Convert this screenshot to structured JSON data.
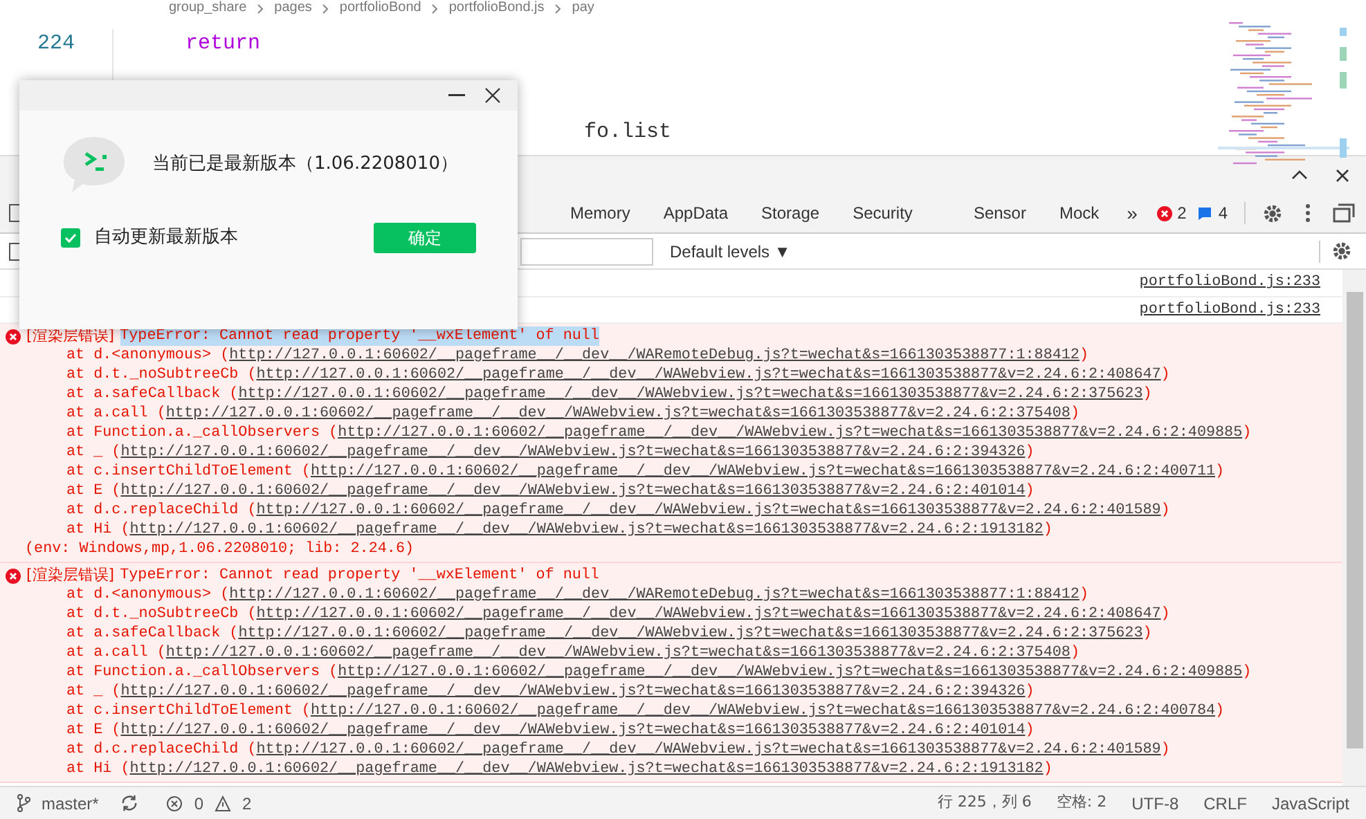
{
  "editor": {
    "breadcrumb": [
      "group_share",
      "pages",
      "portfolioBond",
      "portfolioBond.js",
      "pay"
    ],
    "lines": [
      {
        "number": "224",
        "code": "return"
      },
      {
        "code": "fo.list"
      }
    ]
  },
  "devtools": {
    "tabs": [
      {
        "label": "Memory",
        "selected": false
      },
      {
        "label": "AppData",
        "selected": false
      },
      {
        "label": "Storage",
        "selected": false
      },
      {
        "label": "Security",
        "selected": false
      },
      {
        "label": "Sensor",
        "selected": false
      },
      {
        "label": "Mock",
        "selected": false
      }
    ],
    "more_tabs": "»",
    "error_count": "2",
    "message_count": "4",
    "level_select": "Default levels ▼",
    "console": [
      {
        "kind": "log",
        "source": "portfolioBond.js:233"
      },
      {
        "kind": "log",
        "source": "portfolioBond.js:233"
      },
      {
        "kind": "error",
        "tag": "[渲染层错误]",
        "message": "TypeError: Cannot read property '__wxElement' of null",
        "highlighted": true,
        "stack": [
          {
            "fn": "at d.<anonymous> (",
            "url": "http://127.0.0.1:60602/__pageframe__/__dev__/WARemoteDebug.js?t=wechat&s=1661303538877:1:88412",
            "tail": ")"
          },
          {
            "fn": "at d.t._noSubtreeCb (",
            "url": "http://127.0.0.1:60602/__pageframe__/__dev__/WAWebview.js?t=wechat&s=1661303538877&v=2.24.6:2:408647",
            "tail": ")"
          },
          {
            "fn": "at a.safeCallback (",
            "url": "http://127.0.0.1:60602/__pageframe__/__dev__/WAWebview.js?t=wechat&s=1661303538877&v=2.24.6:2:375623",
            "tail": ")"
          },
          {
            "fn": "at a.call (",
            "url": "http://127.0.0.1:60602/__pageframe__/__dev__/WAWebview.js?t=wechat&s=1661303538877&v=2.24.6:2:375408",
            "tail": ")"
          },
          {
            "fn": "at Function.a._callObservers (",
            "url": "http://127.0.0.1:60602/__pageframe__/__dev__/WAWebview.js?t=wechat&s=1661303538877&v=2.24.6:2:409885",
            "tail": ")"
          },
          {
            "fn": "at _ (",
            "url": "http://127.0.0.1:60602/__pageframe__/__dev__/WAWebview.js?t=wechat&s=1661303538877&v=2.24.6:2:394326",
            "tail": ")"
          },
          {
            "fn": "at c.insertChildToElement (",
            "url": "http://127.0.0.1:60602/__pageframe__/__dev__/WAWebview.js?t=wechat&s=1661303538877&v=2.24.6:2:400711",
            "tail": ")"
          },
          {
            "fn": "at E (",
            "url": "http://127.0.0.1:60602/__pageframe__/__dev__/WAWebview.js?t=wechat&s=1661303538877&v=2.24.6:2:401014",
            "tail": ")"
          },
          {
            "fn": "at d.c.replaceChild (",
            "url": "http://127.0.0.1:60602/__pageframe__/__dev__/WAWebview.js?t=wechat&s=1661303538877&v=2.24.6:2:401589",
            "tail": ")"
          },
          {
            "fn": "at Hi (",
            "url": "http://127.0.0.1:60602/__pageframe__/__dev__/WAWebview.js?t=wechat&s=1661303538877&v=2.24.6:2:1913182",
            "tail": ")"
          }
        ],
        "env": "(env: Windows,mp,1.06.2208010; lib: 2.24.6)"
      },
      {
        "kind": "error",
        "tag": "[渲染层错误]",
        "message": "TypeError: Cannot read property '__wxElement' of null",
        "highlighted": false,
        "stack": [
          {
            "fn": "at d.<anonymous> (",
            "url": "http://127.0.0.1:60602/__pageframe__/__dev__/WARemoteDebug.js?t=wechat&s=1661303538877:1:88412",
            "tail": ")"
          },
          {
            "fn": "at d.t._noSubtreeCb (",
            "url": "http://127.0.0.1:60602/__pageframe__/__dev__/WAWebview.js?t=wechat&s=1661303538877&v=2.24.6:2:408647",
            "tail": ")"
          },
          {
            "fn": "at a.safeCallback (",
            "url": "http://127.0.0.1:60602/__pageframe__/__dev__/WAWebview.js?t=wechat&s=1661303538877&v=2.24.6:2:375623",
            "tail": ")"
          },
          {
            "fn": "at a.call (",
            "url": "http://127.0.0.1:60602/__pageframe__/__dev__/WAWebview.js?t=wechat&s=1661303538877&v=2.24.6:2:375408",
            "tail": ")"
          },
          {
            "fn": "at Function.a._callObservers (",
            "url": "http://127.0.0.1:60602/__pageframe__/__dev__/WAWebview.js?t=wechat&s=1661303538877&v=2.24.6:2:409885",
            "tail": ")"
          },
          {
            "fn": "at _ (",
            "url": "http://127.0.0.1:60602/__pageframe__/__dev__/WAWebview.js?t=wechat&s=1661303538877&v=2.24.6:2:394326",
            "tail": ")"
          },
          {
            "fn": "at c.insertChildToElement (",
            "url": "http://127.0.0.1:60602/__pageframe__/__dev__/WAWebview.js?t=wechat&s=1661303538877&v=2.24.6:2:400784",
            "tail": ")"
          },
          {
            "fn": "at E (",
            "url": "http://127.0.0.1:60602/__pageframe__/__dev__/WAWebview.js?t=wechat&s=1661303538877&v=2.24.6:2:401014",
            "tail": ")"
          },
          {
            "fn": "at d.c.replaceChild (",
            "url": "http://127.0.0.1:60602/__pageframe__/__dev__/WAWebview.js?t=wechat&s=1661303538877&v=2.24.6:2:401589",
            "tail": ")"
          },
          {
            "fn": "at Hi (",
            "url": "http://127.0.0.1:60602/__pageframe__/__dev__/WAWebview.js?t=wechat&s=1661303538877&v=2.24.6:2:1913182",
            "tail": ")"
          }
        ]
      }
    ]
  },
  "dialog": {
    "message": "当前已是最新版本（1.06.2208010）",
    "checkbox": {
      "label": "自动更新最新版本",
      "checked": true
    },
    "ok_button": "确定"
  },
  "status_bar": {
    "branch": "master*",
    "errors": "0",
    "warnings": "2",
    "position": "行 225，列 6",
    "indent": "空格: 2",
    "encoding": "UTF-8",
    "line_ending": "CRLF",
    "language": "JavaScript"
  }
}
